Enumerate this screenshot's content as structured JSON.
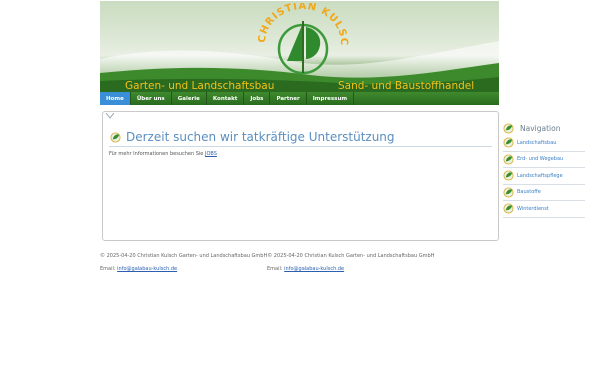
{
  "header": {
    "logo_text": "CHRISTIAN KULSCH",
    "left_tagline": "Garten- und Landschaftsbau",
    "right_tagline": "Sand- und Baustoffhandel"
  },
  "nav": {
    "items": [
      {
        "label": "Home",
        "active": true
      },
      {
        "label": "Über uns",
        "active": false
      },
      {
        "label": "Galerie",
        "active": false
      },
      {
        "label": "Kontakt",
        "active": false
      },
      {
        "label": "Jobs",
        "active": false
      },
      {
        "label": "Partner",
        "active": false
      },
      {
        "label": "Impressum",
        "active": false
      }
    ]
  },
  "main": {
    "headline": "Derzeit suchen wir tatkräftige Unterstützung",
    "info_prefix": "Für mehr Informationen besuchen Sie ",
    "info_link": "JOBS"
  },
  "sidebar": {
    "title": "Navigation",
    "items": [
      {
        "label": "Landschaftsbau",
        "icon": "leaf-icon"
      },
      {
        "label": "Erd- und Wegebau",
        "icon": "leaf-icon"
      },
      {
        "label": "Landschaftspflege",
        "icon": "leaf-icon"
      },
      {
        "label": "Baustoffe",
        "icon": "leaf-icon"
      },
      {
        "label": "Winterdienst",
        "icon": "leaf-icon"
      }
    ]
  },
  "footer": {
    "copyright": "© 2025-04-20 Christian Kulsch Garten- und Landschaftsbau GmbH© 2025-04-20 Christian Kulsch Garten- und Landschaftsbau GmbH",
    "email_label": "Email: ",
    "email_1": "info@galabau-kulsch.de",
    "email_2": "info@galabau-kulsch.de"
  },
  "colors": {
    "brand_green": "#2f7a25",
    "brand_yellow": "#f0c419",
    "accent_blue": "#3b8fd9",
    "link_blue": "#2c5fb0"
  }
}
